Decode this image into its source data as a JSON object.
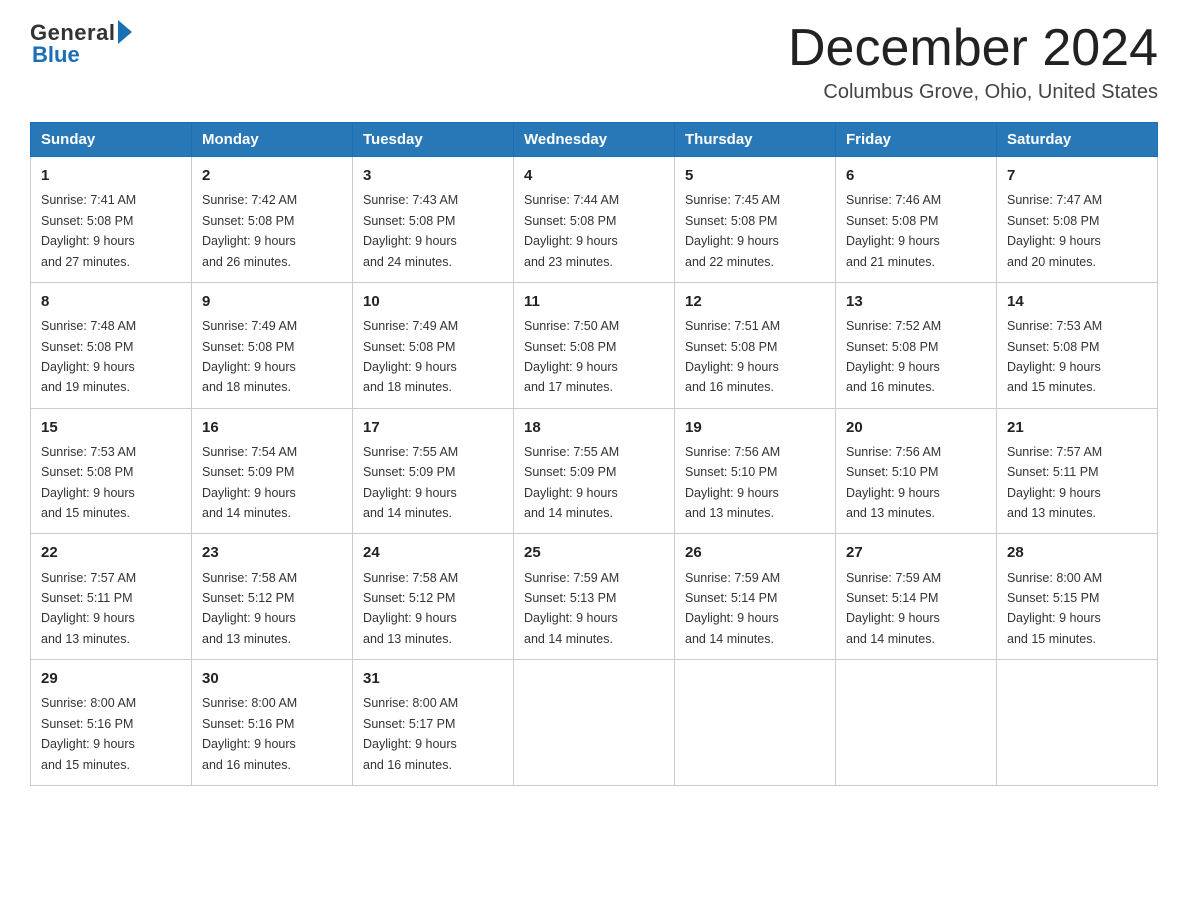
{
  "header": {
    "logo_general": "General",
    "logo_blue": "Blue",
    "title": "December 2024",
    "location": "Columbus Grove, Ohio, United States"
  },
  "days_of_week": [
    "Sunday",
    "Monday",
    "Tuesday",
    "Wednesday",
    "Thursday",
    "Friday",
    "Saturday"
  ],
  "weeks": [
    [
      {
        "day": "1",
        "sunrise": "7:41 AM",
        "sunset": "5:08 PM",
        "daylight": "9 hours and 27 minutes."
      },
      {
        "day": "2",
        "sunrise": "7:42 AM",
        "sunset": "5:08 PM",
        "daylight": "9 hours and 26 minutes."
      },
      {
        "day": "3",
        "sunrise": "7:43 AM",
        "sunset": "5:08 PM",
        "daylight": "9 hours and 24 minutes."
      },
      {
        "day": "4",
        "sunrise": "7:44 AM",
        "sunset": "5:08 PM",
        "daylight": "9 hours and 23 minutes."
      },
      {
        "day": "5",
        "sunrise": "7:45 AM",
        "sunset": "5:08 PM",
        "daylight": "9 hours and 22 minutes."
      },
      {
        "day": "6",
        "sunrise": "7:46 AM",
        "sunset": "5:08 PM",
        "daylight": "9 hours and 21 minutes."
      },
      {
        "day": "7",
        "sunrise": "7:47 AM",
        "sunset": "5:08 PM",
        "daylight": "9 hours and 20 minutes."
      }
    ],
    [
      {
        "day": "8",
        "sunrise": "7:48 AM",
        "sunset": "5:08 PM",
        "daylight": "9 hours and 19 minutes."
      },
      {
        "day": "9",
        "sunrise": "7:49 AM",
        "sunset": "5:08 PM",
        "daylight": "9 hours and 18 minutes."
      },
      {
        "day": "10",
        "sunrise": "7:49 AM",
        "sunset": "5:08 PM",
        "daylight": "9 hours and 18 minutes."
      },
      {
        "day": "11",
        "sunrise": "7:50 AM",
        "sunset": "5:08 PM",
        "daylight": "9 hours and 17 minutes."
      },
      {
        "day": "12",
        "sunrise": "7:51 AM",
        "sunset": "5:08 PM",
        "daylight": "9 hours and 16 minutes."
      },
      {
        "day": "13",
        "sunrise": "7:52 AM",
        "sunset": "5:08 PM",
        "daylight": "9 hours and 16 minutes."
      },
      {
        "day": "14",
        "sunrise": "7:53 AM",
        "sunset": "5:08 PM",
        "daylight": "9 hours and 15 minutes."
      }
    ],
    [
      {
        "day": "15",
        "sunrise": "7:53 AM",
        "sunset": "5:08 PM",
        "daylight": "9 hours and 15 minutes."
      },
      {
        "day": "16",
        "sunrise": "7:54 AM",
        "sunset": "5:09 PM",
        "daylight": "9 hours and 14 minutes."
      },
      {
        "day": "17",
        "sunrise": "7:55 AM",
        "sunset": "5:09 PM",
        "daylight": "9 hours and 14 minutes."
      },
      {
        "day": "18",
        "sunrise": "7:55 AM",
        "sunset": "5:09 PM",
        "daylight": "9 hours and 14 minutes."
      },
      {
        "day": "19",
        "sunrise": "7:56 AM",
        "sunset": "5:10 PM",
        "daylight": "9 hours and 13 minutes."
      },
      {
        "day": "20",
        "sunrise": "7:56 AM",
        "sunset": "5:10 PM",
        "daylight": "9 hours and 13 minutes."
      },
      {
        "day": "21",
        "sunrise": "7:57 AM",
        "sunset": "5:11 PM",
        "daylight": "9 hours and 13 minutes."
      }
    ],
    [
      {
        "day": "22",
        "sunrise": "7:57 AM",
        "sunset": "5:11 PM",
        "daylight": "9 hours and 13 minutes."
      },
      {
        "day": "23",
        "sunrise": "7:58 AM",
        "sunset": "5:12 PM",
        "daylight": "9 hours and 13 minutes."
      },
      {
        "day": "24",
        "sunrise": "7:58 AM",
        "sunset": "5:12 PM",
        "daylight": "9 hours and 13 minutes."
      },
      {
        "day": "25",
        "sunrise": "7:59 AM",
        "sunset": "5:13 PM",
        "daylight": "9 hours and 14 minutes."
      },
      {
        "day": "26",
        "sunrise": "7:59 AM",
        "sunset": "5:14 PM",
        "daylight": "9 hours and 14 minutes."
      },
      {
        "day": "27",
        "sunrise": "7:59 AM",
        "sunset": "5:14 PM",
        "daylight": "9 hours and 14 minutes."
      },
      {
        "day": "28",
        "sunrise": "8:00 AM",
        "sunset": "5:15 PM",
        "daylight": "9 hours and 15 minutes."
      }
    ],
    [
      {
        "day": "29",
        "sunrise": "8:00 AM",
        "sunset": "5:16 PM",
        "daylight": "9 hours and 15 minutes."
      },
      {
        "day": "30",
        "sunrise": "8:00 AM",
        "sunset": "5:16 PM",
        "daylight": "9 hours and 16 minutes."
      },
      {
        "day": "31",
        "sunrise": "8:00 AM",
        "sunset": "5:17 PM",
        "daylight": "9 hours and 16 minutes."
      },
      null,
      null,
      null,
      null
    ]
  ],
  "labels": {
    "sunrise": "Sunrise:",
    "sunset": "Sunset:",
    "daylight": "Daylight:"
  }
}
